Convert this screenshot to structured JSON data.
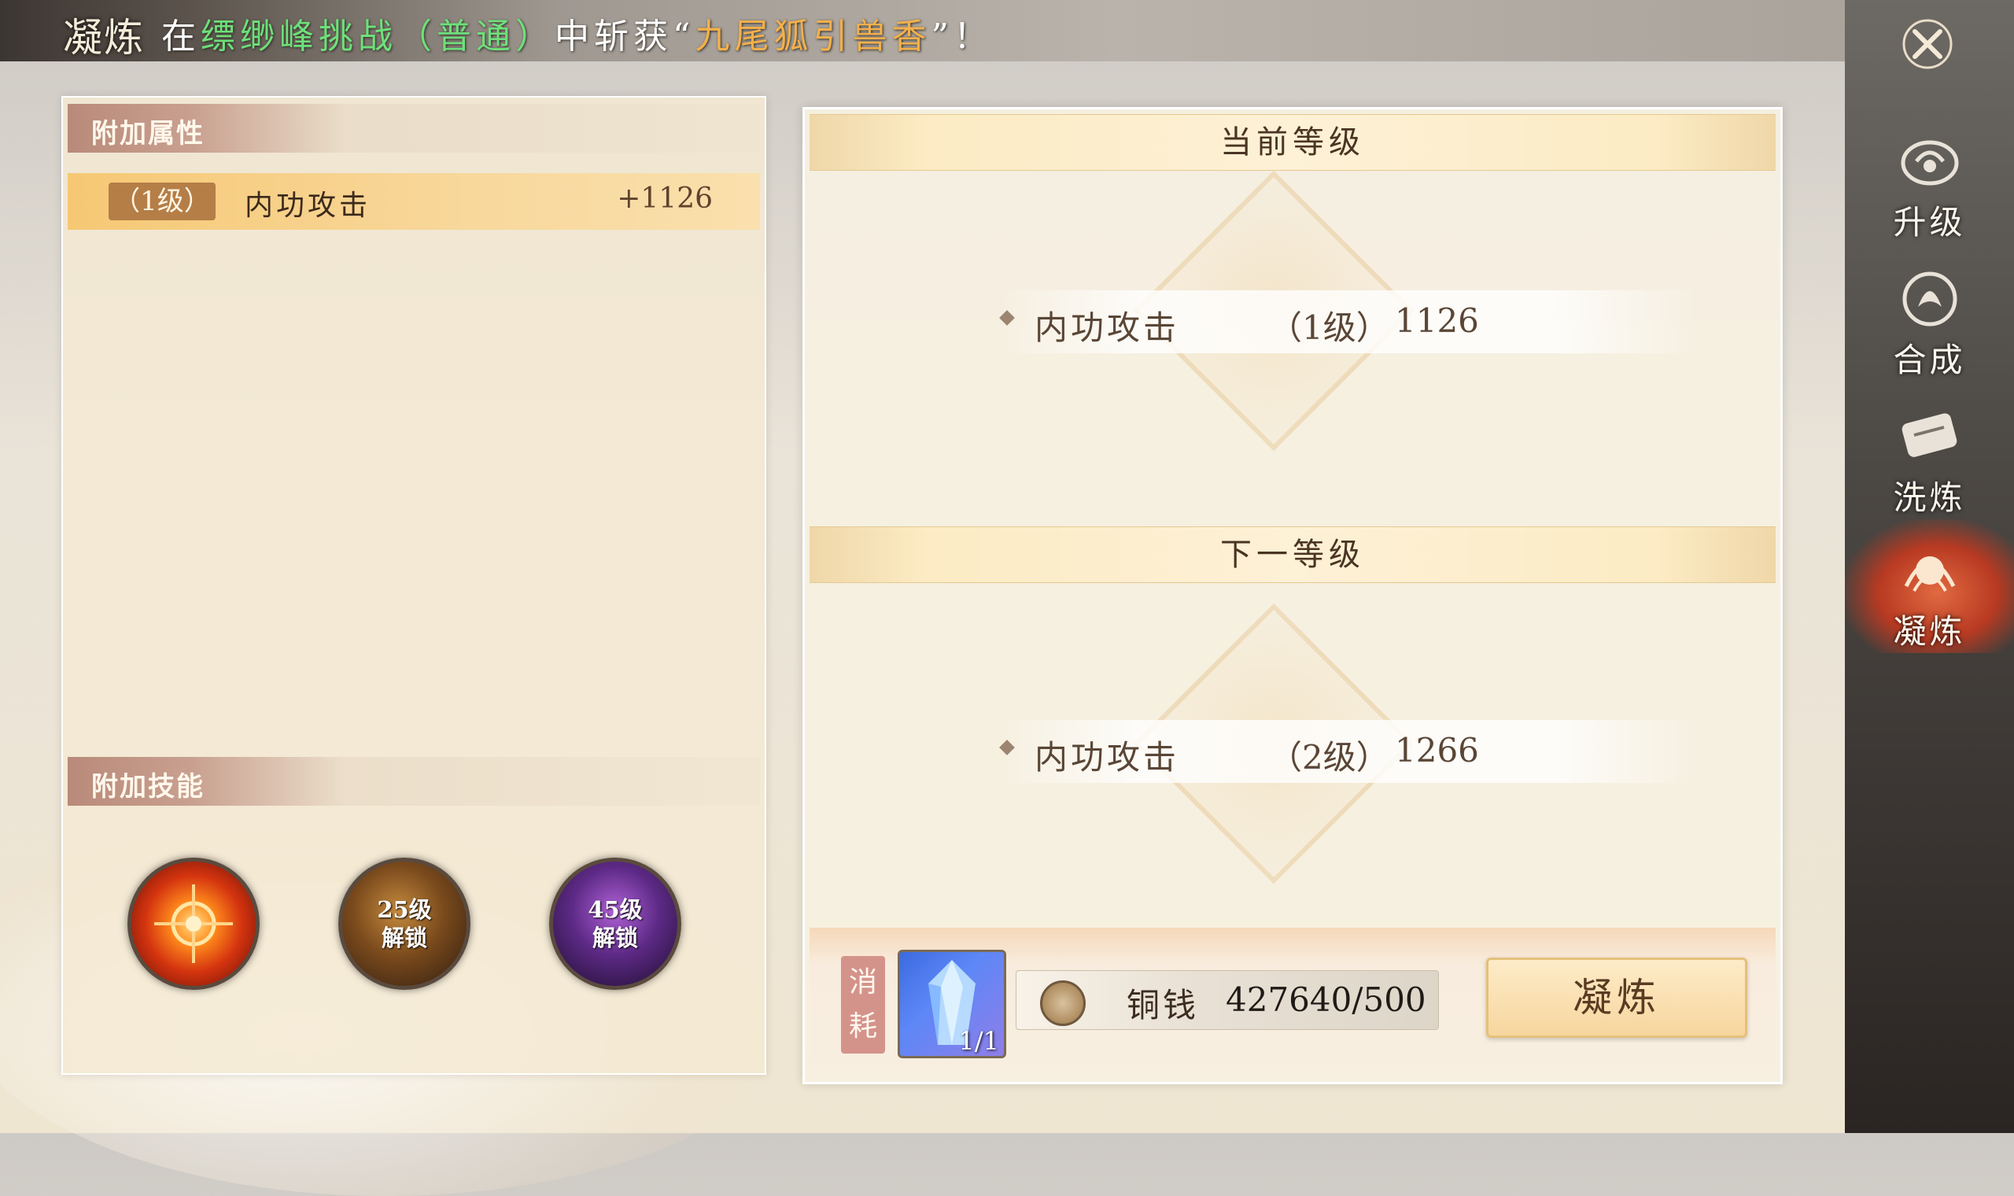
{
  "header": {
    "title": "凝炼",
    "ticker": {
      "prefix": "在",
      "place": "缥缈峰挑战（普通）",
      "mid": "中斩获“",
      "item": "九尾狐引兽香",
      "suffix": "”！"
    }
  },
  "nav": {
    "items": [
      {
        "label": "升级",
        "icon": "upgrade-icon"
      },
      {
        "label": "合成",
        "icon": "synthesis-icon"
      },
      {
        "label": "洗炼",
        "icon": "reforge-icon"
      },
      {
        "label": "凝炼",
        "icon": "refine-icon",
        "active": true
      }
    ]
  },
  "left_panel": {
    "attr_section_title": "附加属性",
    "attributes": [
      {
        "level": "（1级）",
        "name": "内功攻击",
        "value": "+1126"
      }
    ],
    "skill_section_title": "附加技能",
    "skills": [
      {
        "name": "fire-skill-icon",
        "locked": false,
        "lock_text_1": "",
        "lock_text_2": ""
      },
      {
        "name": "locked-skill-icon",
        "locked": true,
        "lock_text_1": "25级",
        "lock_text_2": "解锁"
      },
      {
        "name": "locked-skill-icon",
        "locked": true,
        "lock_text_1": "45级",
        "lock_text_2": "解锁"
      }
    ]
  },
  "right_panel": {
    "current": {
      "title": "当前等级",
      "stat_name": "内功攻击",
      "stat_level": "（1级）",
      "stat_value": "1126"
    },
    "next": {
      "title": "下一等级",
      "stat_name": "内功攻击",
      "stat_level": "（2级）",
      "stat_value": "1266"
    },
    "cost": {
      "tag_line1": "消",
      "tag_line2": "耗",
      "item_count": "1/1",
      "currency_label": "铜钱",
      "currency_value": "427640/500"
    },
    "action_label": "凝炼"
  },
  "colors": {
    "ticker_place": "#6ee07a",
    "ticker_item": "#f3b04b",
    "nav_active": "#b83a22",
    "attr_row": "#f6c874"
  }
}
